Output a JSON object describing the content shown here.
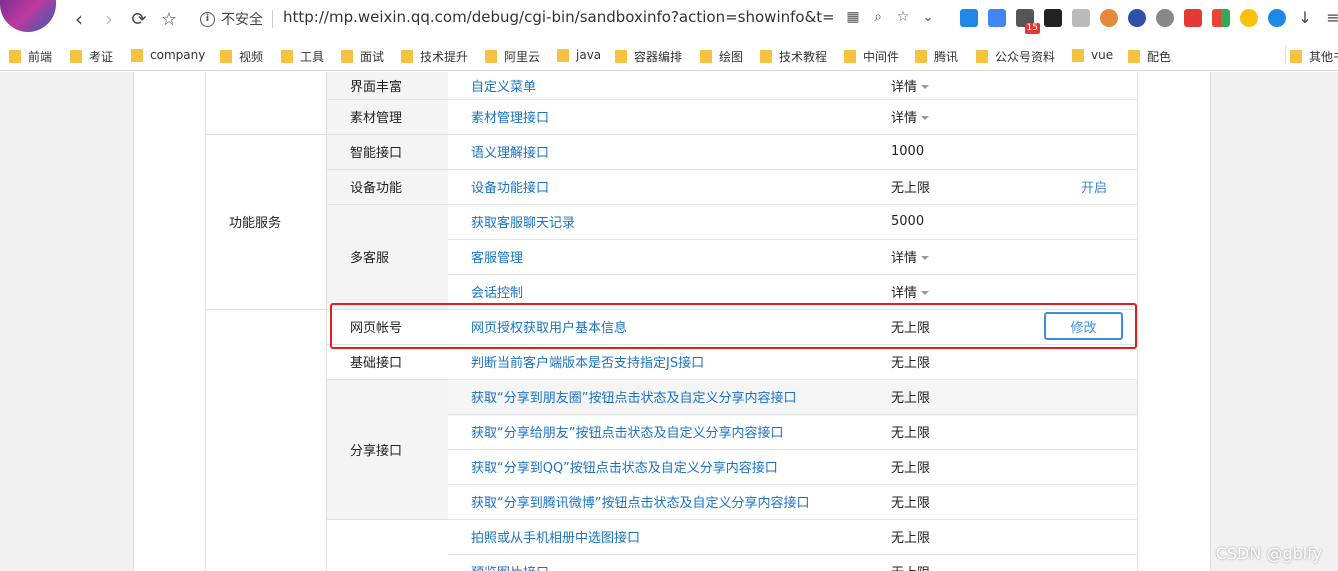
{
  "browser": {
    "security_label": "不安全",
    "url": "http://mp.weixin.qq.com/debug/cgi-bin/sandboxinfo?action=showinfo&t=sand...",
    "extension_badge": "15",
    "bookmarks": [
      "前端",
      "考证",
      "company",
      "视频",
      "工具",
      "面试",
      "技术提升",
      "阿里云",
      "java",
      "容器编排",
      "绘图",
      "技术教程",
      "中间件",
      "腾讯",
      "公众号资料",
      "vue",
      "配色",
      "其他书"
    ]
  },
  "table": {
    "groups": [
      {
        "label": "功能服务"
      }
    ],
    "categories": [
      "界面丰富",
      "素材管理",
      "智能接口",
      "设备功能",
      "多客服",
      "网页帐号",
      "基础接口",
      "分享接口"
    ],
    "rows": [
      {
        "name": "自定义菜单",
        "quota": "详情",
        "caret": true,
        "op": ""
      },
      {
        "name": "素材管理接口",
        "quota": "详情",
        "caret": true,
        "op": ""
      },
      {
        "name": "语义理解接口",
        "quota": "1000",
        "caret": false,
        "op": ""
      },
      {
        "name": "设备功能接口",
        "quota": "无上限",
        "caret": false,
        "op": "开启"
      },
      {
        "name": "获取客服聊天记录",
        "quota": "5000",
        "caret": false,
        "op": ""
      },
      {
        "name": "客服管理",
        "quota": "详情",
        "caret": true,
        "op": ""
      },
      {
        "name": "会话控制",
        "quota": "详情",
        "caret": true,
        "op": ""
      },
      {
        "name": "网页授权获取用户基本信息",
        "quota": "无上限",
        "caret": false,
        "op": "修改"
      },
      {
        "name": "判断当前客户端版本是否支持指定JS接口",
        "quota": "无上限",
        "caret": false,
        "op": ""
      },
      {
        "name": "获取“分享到朋友圈”按钮点击状态及自定义分享内容接口",
        "quota": "无上限",
        "caret": false,
        "op": ""
      },
      {
        "name": "获取“分享给朋友”按钮点击状态及自定义分享内容接口",
        "quota": "无上限",
        "caret": false,
        "op": ""
      },
      {
        "name": "获取“分享到QQ”按钮点击状态及自定义分享内容接口",
        "quota": "无上限",
        "caret": false,
        "op": ""
      },
      {
        "name": "获取“分享到腾讯微博”按钮点击状态及自定义分享内容接口",
        "quota": "无上限",
        "caret": false,
        "op": ""
      },
      {
        "name": "拍照或从手机相册中选图接口",
        "quota": "无上限",
        "caret": false,
        "op": ""
      },
      {
        "name": "预览图片接口",
        "quota": "无上限",
        "caret": false,
        "op": ""
      }
    ]
  },
  "watermark": "CSDN @gblfy",
  "colors": {
    "link": "#1a73c9",
    "highlight_box": "#e02020",
    "button_border": "#3a8ee6"
  }
}
